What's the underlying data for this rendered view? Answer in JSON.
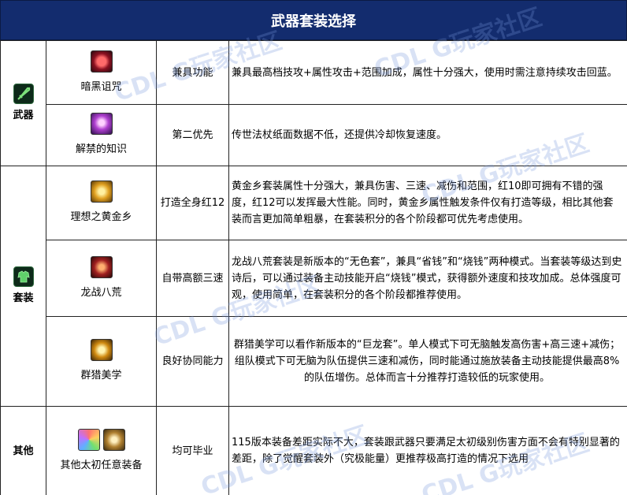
{
  "title": "武器套装选择",
  "watermark": "CDL G玩家社区",
  "categories": [
    {
      "name": "武器",
      "icon": "green-sword-icon",
      "items": [
        {
          "name": "暗黑诅咒",
          "icon": "dark-curse-icon",
          "feature": "兼具功能",
          "desc": "兼具最高档技攻+属性攻击+范围加成，属性十分强大，使用时需注意持续攻击回蓝。"
        },
        {
          "name": "解禁的知识",
          "icon": "forbidden-knowledge-icon",
          "feature": "第二优先",
          "desc": "传世法杖纸面数据不低，还提供冷却恢复速度。"
        }
      ]
    },
    {
      "name": "套装",
      "icon": "green-armor-icon",
      "items": [
        {
          "name": "理想之黄金乡",
          "icon": "golden-armor-icon",
          "feature": "打造全身红12",
          "desc": "黄金乡套装属性十分强大，兼具伤害、三速、减伤和范围，红10即可拥有不错的强度，红12可以发挥最大性能。同时，黄金乡属性触发条件仅有打造等级，相比其他套装而言更加简单粗暴，在套装积分的各个阶段都可优先考虑使用。"
        },
        {
          "name": "龙战八荒",
          "icon": "dragon-armor-icon",
          "feature": "自带高额三速",
          "desc": "龙战八荒套装是新版本的“无色套”，兼具“省钱”和“烧钱”两种模式。当套装等级达到史诗后，可以通过装备主动技能开启“烧钱”模式，获得额外速度和技攻加成。总体强度可观，使用简单，在套装积分的各个阶段都推荐使用。"
        },
        {
          "name": "群猎美学",
          "icon": "hunting-aesthetics-icon",
          "feature": "良好协同能力",
          "desc": "群猎美学可以看作新版本的“巨龙套”。单人模式下可无脑触发高伤害+高三速+减伤；组队模式下可无脑为队伍提供三速和减伤，同时能通过施放装备主动技能提供最高8%的队伍增伤。总体而言十分推荐打造较低的玩家使用。"
        }
      ]
    },
    {
      "name": "其他",
      "icon": "",
      "items": [
        {
          "name": "其他太初任意装备",
          "icons": [
            "rainbow-orb-icon",
            "golden-gauntlet-icon"
          ],
          "feature": "均可毕业",
          "desc": "115版本装备差距实际不大，套装跟武器只要满足太初级别伤害方面不会有特别显著的差距，除了觉醒套装外（究极能量）更推荐极高打造的情况下选用"
        }
      ]
    }
  ]
}
